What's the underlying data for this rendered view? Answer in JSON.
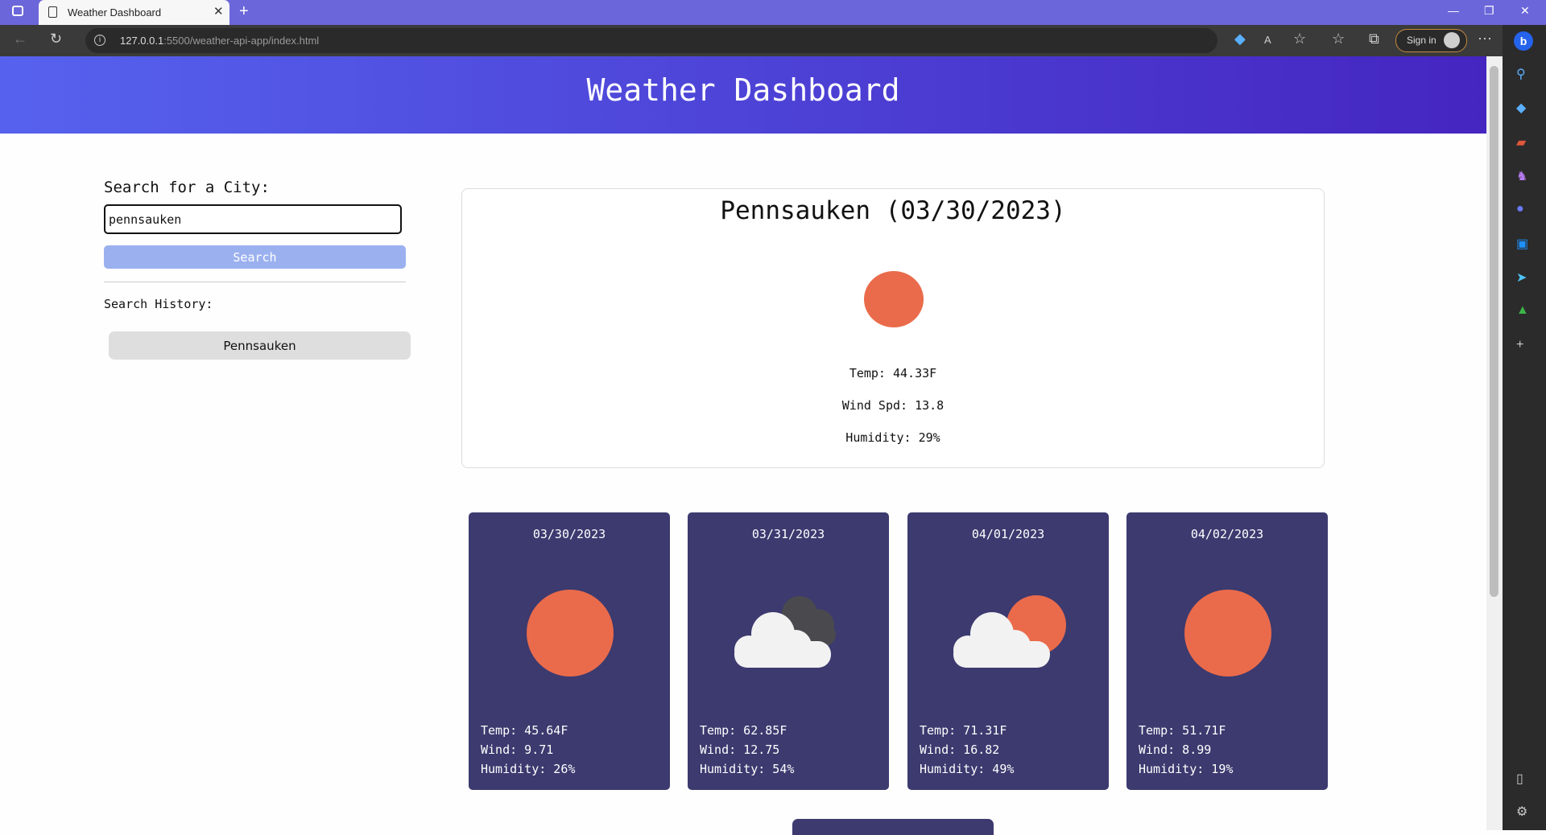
{
  "browser": {
    "tab_title": "Weather Dashboard",
    "url_host": "127.0.0.1",
    "url_rest": ":5500/weather-api-app/index.html",
    "sign_in": "Sign in"
  },
  "page": {
    "title": "Weather Dashboard",
    "search_label": "Search for a City:",
    "search_value": "pennsauken",
    "search_button": "Search",
    "history_label": "Search History:",
    "history": [
      "Pennsauken"
    ]
  },
  "current": {
    "title": "Pennsauken (03/30/2023)",
    "icon": "sun-icon",
    "temp": "Temp: 44.33F",
    "wind": "Wind Spd: 13.8",
    "humidity": "Humidity: 29%"
  },
  "forecast": [
    {
      "date": "03/30/2023",
      "icon": "sun-icon",
      "temp": "Temp: 45.64F",
      "wind": "Wind: 9.71",
      "humidity": "Humidity: 26%"
    },
    {
      "date": "03/31/2023",
      "icon": "overcast-cloud-icon",
      "temp": "Temp: 62.85F",
      "wind": "Wind: 12.75",
      "humidity": "Humidity: 54%"
    },
    {
      "date": "04/01/2023",
      "icon": "partly-cloudy-icon",
      "temp": "Temp: 71.31F",
      "wind": "Wind: 16.82",
      "humidity": "Humidity: 49%"
    },
    {
      "date": "04/02/2023",
      "icon": "sun-icon",
      "temp": "Temp: 51.71F",
      "wind": "Wind: 8.99",
      "humidity": "Humidity: 19%"
    }
  ],
  "colors": {
    "header_start": "#5662ee",
    "header_end": "#4525c0",
    "card_bg": "#3c3a6f",
    "sun": "#ea6b4b",
    "search_button": "#9bb1ef"
  }
}
